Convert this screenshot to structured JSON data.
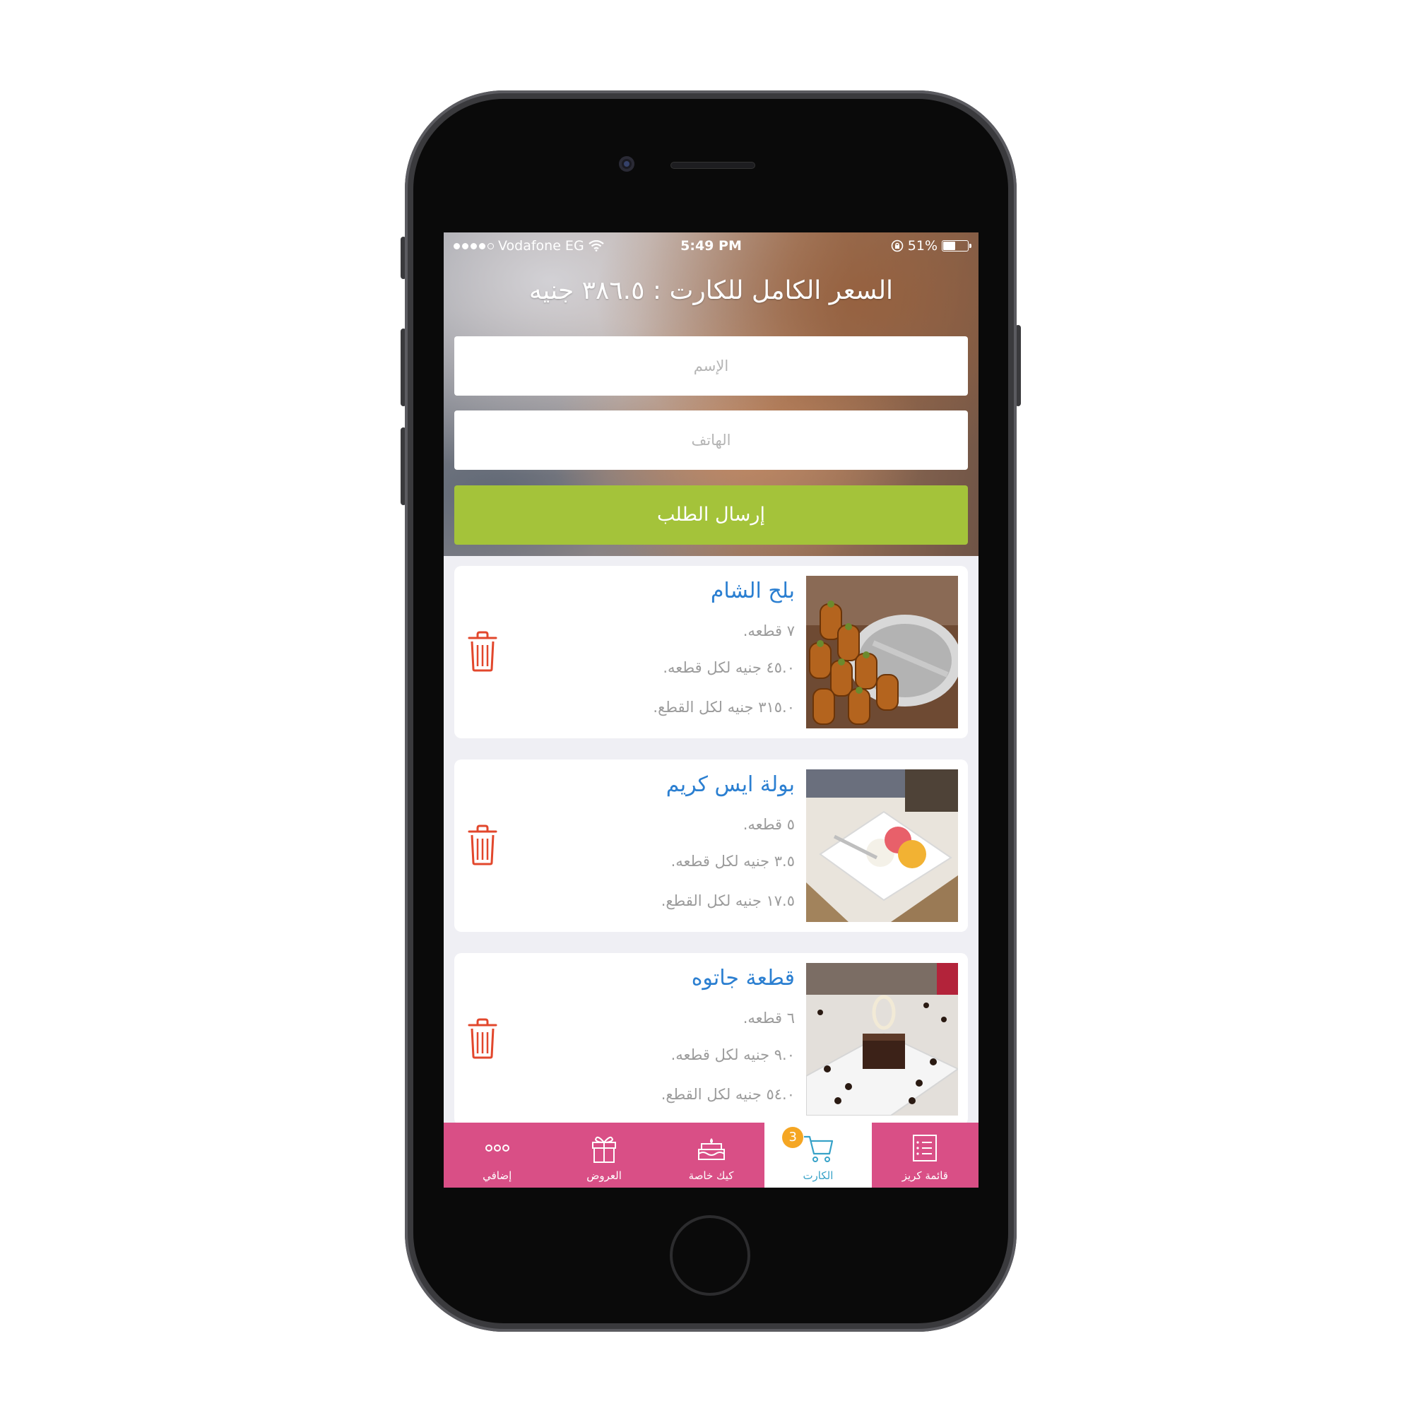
{
  "status_bar": {
    "carrier": "Vodafone EG",
    "time": "5:49 PM",
    "battery": "51%",
    "battery_level": 0.51,
    "signal_bars_filled": 4,
    "signal_bars_total": 5
  },
  "header": {
    "total_text": "السعر الكامل للكارت : ٣٨٦.٥ جنيه"
  },
  "form": {
    "name_placeholder": "الإسم",
    "phone_placeholder": "الهاتف",
    "submit_label": "إرسال الطلب"
  },
  "cart": {
    "items": [
      {
        "title": "بلح الشام",
        "quantity": "٧ قطعه.",
        "unit_price": "٤٥.٠ جنيه لكل قطعه.",
        "total_price": "٣١٥.٠ جنيه لكل القطع.",
        "photo": "balah-el-sham-photo"
      },
      {
        "title": "بولة ايس كريم",
        "quantity": "٥ قطعه.",
        "unit_price": "٣.٥ جنيه لكل قطعه.",
        "total_price": "١٧.٥ جنيه لكل القطع.",
        "photo": "ice-cream-scoop-photo"
      },
      {
        "title": "قطعة جاتوه",
        "quantity": "٦ قطعه.",
        "unit_price": "٩.٠ جنيه لكل قطعه.",
        "total_price": "٥٤.٠ جنيه لكل القطع.",
        "photo": "gateau-slice-photo"
      }
    ]
  },
  "tabbar": {
    "tabs": [
      {
        "label": "إضافي",
        "icon": "more-dots-icon"
      },
      {
        "label": "العروض",
        "icon": "gift-icon"
      },
      {
        "label": "كيك خاصة",
        "icon": "cake-icon"
      },
      {
        "label": "الكارت",
        "icon": "cart-icon",
        "badge": "3",
        "active": true
      },
      {
        "label": "قائمة كريز",
        "icon": "list-icon"
      }
    ]
  },
  "colors": {
    "accent_green": "#a4c33a",
    "tab_pink": "#d94f86",
    "title_blue": "#2b7fd1",
    "trash_red": "#e2472c",
    "badge_orange": "#f5a623",
    "active_tab_blue": "#37a2c8"
  }
}
